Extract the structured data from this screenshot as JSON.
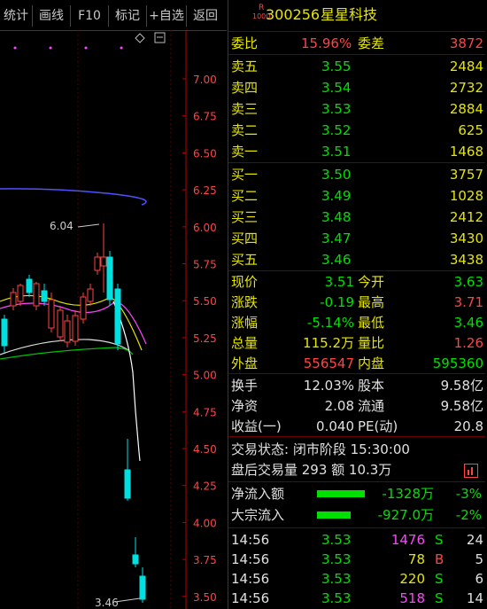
{
  "toolbar": {
    "buttons": [
      "统计",
      "画线",
      "F10",
      "标记",
      "+自选",
      "返回"
    ]
  },
  "chart": {
    "price_ticks": [
      "7.00",
      "6.75",
      "6.50",
      "6.25",
      "6.00",
      "5.75",
      "5.50",
      "5.25",
      "5.00",
      "4.75",
      "4.50",
      "4.25",
      "4.00",
      "3.75",
      "3.50"
    ],
    "high_label": "6.04",
    "low_label": "3.46"
  },
  "header": {
    "badge_top": "R",
    "badge_bottom": "1000",
    "code": "300256",
    "name": "星星科技"
  },
  "weibi": {
    "label1": "委比",
    "value1": "15.96%",
    "label2": "委差",
    "value2": "3872"
  },
  "asks": [
    {
      "label": "卖五",
      "price": "3.55",
      "vol": "2484"
    },
    {
      "label": "卖四",
      "price": "3.54",
      "vol": "2732"
    },
    {
      "label": "卖三",
      "price": "3.53",
      "vol": "2884"
    },
    {
      "label": "卖二",
      "price": "3.52",
      "vol": "625"
    },
    {
      "label": "卖一",
      "price": "3.51",
      "vol": "1468"
    }
  ],
  "bids": [
    {
      "label": "买一",
      "price": "3.50",
      "vol": "3757"
    },
    {
      "label": "买二",
      "price": "3.49",
      "vol": "1028"
    },
    {
      "label": "买三",
      "price": "3.48",
      "vol": "2412"
    },
    {
      "label": "买四",
      "price": "3.47",
      "vol": "3430"
    },
    {
      "label": "买五",
      "price": "3.46",
      "vol": "3438"
    }
  ],
  "quote": [
    {
      "l1": "现价",
      "v1": "3.51",
      "l2": "今开",
      "v2": "3.63"
    },
    {
      "l1": "涨跌",
      "v1": "-0.19",
      "l2": "最高",
      "v2": "3.71"
    },
    {
      "l1": "涨幅",
      "v1": "-5.14%",
      "l2": "最低",
      "v2": "3.46"
    },
    {
      "l1": "总量",
      "v1": "115.2万",
      "l2": "量比",
      "v2": "1.26"
    },
    {
      "l1": "外盘",
      "v1": "556547",
      "l2": "内盘",
      "v2": "595360"
    }
  ],
  "fundamentals": [
    {
      "l1": "换手",
      "v1": "12.03%",
      "l2": "股本",
      "v2": "9.58亿"
    },
    {
      "l1": "净资",
      "v1": "2.08",
      "l2": "流通",
      "v2": "9.58亿"
    },
    {
      "l1": "收益(一)",
      "v1": "0.040",
      "l2": "PE(动)",
      "v2": "20.8"
    }
  ],
  "status": {
    "line1": "交易状态: 闭市阶段 15:30:00",
    "line2": "盘后交易量 293 额 10.3万"
  },
  "flows": [
    {
      "label": "净流入额",
      "value": "-1328万",
      "pct": "-3%",
      "bar_fraction": 1.0
    },
    {
      "label": "大宗流入",
      "value": "-927.0万",
      "pct": "-2%",
      "bar_fraction": 0.7
    }
  ],
  "ticks": [
    {
      "time": "14:56",
      "price": "3.53",
      "vol": "1476",
      "side": "S",
      "n": "24"
    },
    {
      "time": "14:56",
      "price": "3.53",
      "vol": "78",
      "side": "B",
      "n": "5"
    },
    {
      "time": "14:56",
      "price": "3.53",
      "vol": "220",
      "side": "S",
      "n": "6"
    },
    {
      "time": "14:56",
      "price": "3.53",
      "vol": "518",
      "side": "S",
      "n": "14"
    }
  ],
  "colors": {
    "up": "#ff4444",
    "down": "#00e000",
    "label": "#e6e600",
    "border": "#b80000"
  }
}
